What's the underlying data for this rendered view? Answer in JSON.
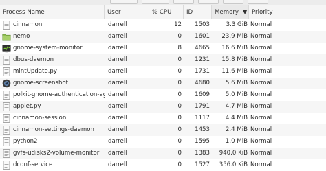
{
  "columns": {
    "name": "Process Name",
    "user": "User",
    "cpu": "% CPU",
    "id": "ID",
    "memory": "Memory",
    "priority": "Priority"
  },
  "sort": {
    "column": "memory",
    "direction": "descending",
    "arrow_icon": "chevron-down-icon"
  },
  "rows": [
    {
      "name": "cinnamon",
      "user": "darrell",
      "cpu": "12",
      "id": "1503",
      "memory": "3.3 GiB",
      "priority": "Normal",
      "icon": "generic-app-icon"
    },
    {
      "name": "nemo",
      "user": "darrell",
      "cpu": "0",
      "id": "1601",
      "memory": "23.9 MiB",
      "priority": "Normal",
      "icon": "folder-icon"
    },
    {
      "name": "gnome-system-monitor",
      "user": "darrell",
      "cpu": "8",
      "id": "4665",
      "memory": "16.6 MiB",
      "priority": "Normal",
      "icon": "system-monitor-icon"
    },
    {
      "name": "dbus-daemon",
      "user": "darrell",
      "cpu": "0",
      "id": "1231",
      "memory": "15.8 MiB",
      "priority": "Normal",
      "icon": "generic-app-icon"
    },
    {
      "name": "mintUpdate.py",
      "user": "darrell",
      "cpu": "0",
      "id": "1731",
      "memory": "11.6 MiB",
      "priority": "Normal",
      "icon": "generic-app-icon"
    },
    {
      "name": "gnome-screenshot",
      "user": "darrell",
      "cpu": "0",
      "id": "4680",
      "memory": "5.6 MiB",
      "priority": "Normal",
      "icon": "camera-icon"
    },
    {
      "name": "polkit-gnome-authentication-agent-",
      "user": "darrell",
      "cpu": "0",
      "id": "1609",
      "memory": "5.0 MiB",
      "priority": "Normal",
      "icon": "generic-app-icon"
    },
    {
      "name": "applet.py",
      "user": "darrell",
      "cpu": "0",
      "id": "1791",
      "memory": "4.7 MiB",
      "priority": "Normal",
      "icon": "generic-app-icon"
    },
    {
      "name": "cinnamon-session",
      "user": "darrell",
      "cpu": "0",
      "id": "1117",
      "memory": "4.4 MiB",
      "priority": "Normal",
      "icon": "generic-app-icon"
    },
    {
      "name": "cinnamon-settings-daemon",
      "user": "darrell",
      "cpu": "0",
      "id": "1453",
      "memory": "2.4 MiB",
      "priority": "Normal",
      "icon": "generic-app-icon"
    },
    {
      "name": "python2",
      "user": "darrell",
      "cpu": "0",
      "id": "1595",
      "memory": "1.0 MiB",
      "priority": "Normal",
      "icon": "generic-app-icon"
    },
    {
      "name": "gvfs-udisks2-volume-monitor",
      "user": "darrell",
      "cpu": "0",
      "id": "1383",
      "memory": "940.0 KiB",
      "priority": "Normal",
      "icon": "generic-app-icon"
    },
    {
      "name": "dconf-service",
      "user": "darrell",
      "cpu": "0",
      "id": "1527",
      "memory": "356.0 KiB",
      "priority": "Normal",
      "icon": "generic-app-icon"
    }
  ]
}
